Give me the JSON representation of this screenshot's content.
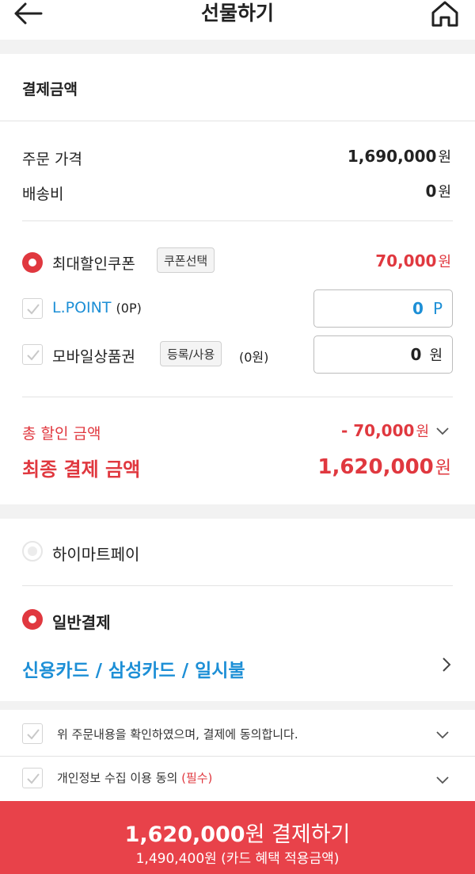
{
  "header": {
    "title": "선물하기",
    "back_icon": "arrow-left-icon",
    "home_icon": "home-icon"
  },
  "payment_amount": {
    "section_title": "결제금액",
    "order_price_label": "주문 가격",
    "order_price_value": "1,690,000",
    "shipping_label": "배송비",
    "shipping_value": "0",
    "unit": "원"
  },
  "discounts": {
    "coupon_label": "최대할인쿠폰",
    "coupon_button": "쿠폰선택",
    "coupon_value": "70,000",
    "lpoint_label": "L.POINT",
    "lpoint_balance": "(0P)",
    "lpoint_input_value": "0",
    "lpoint_unit": "P",
    "giftcard_label": "모바일상품권",
    "giftcard_button": "등록/사용",
    "giftcard_balance": "(0원)",
    "giftcard_input_value": "0",
    "giftcard_unit": "원"
  },
  "totals": {
    "total_discount_label": "총 할인 금액",
    "total_discount_value": "- 70,000",
    "final_label": "최종 결제 금액",
    "final_value": "1,620,000",
    "unit": "원"
  },
  "payment_methods": {
    "himart_pay_label": "하이마트페이",
    "general_label": "일반결제",
    "card_selection": "신용카드 / 삼성카드 / 일시불"
  },
  "agreements": [
    {
      "text": "위 주문내용을 확인하였으며, 결제에 동의합니다.",
      "required": ""
    },
    {
      "text": "개인정보 수집 이용 동의",
      "required": "(필수)"
    }
  ],
  "pay_button": {
    "amount": "1,620,000",
    "unit_label": "원 결제하기",
    "sub_text": "1,490,400원 (카드 혜택 적용금액)"
  },
  "colors": {
    "accent_red": "#e0383f",
    "link_blue": "#1d8fd6",
    "pay_bar": "#e8424a"
  }
}
